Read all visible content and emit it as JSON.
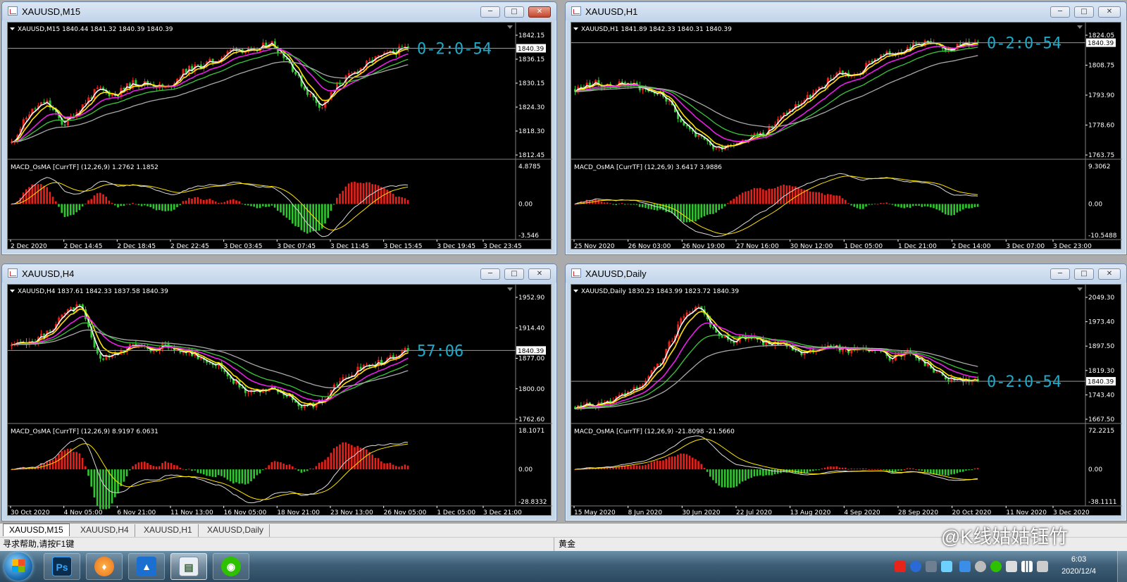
{
  "windows": [
    {
      "id": "m15",
      "title": "XAUUSD,M15",
      "active": true,
      "header": "XAUUSD,M15  1840.44 1841.32 1840.39 1840.39",
      "prices": [
        "1842.15",
        "1836.15",
        "1830.15",
        "1824.30",
        "1818.30",
        "1812.45"
      ],
      "bid": "1840.39",
      "timer": "0-2:0-54",
      "macd_header": "MACD_OsMA [CurrTF] (12,26,9) 1.2762 1.1852",
      "macd_scale": [
        "4.8785",
        "0.00",
        "-3.546"
      ],
      "times": [
        "2 Dec 2020",
        "2 Dec 14:45",
        "2 Dec 18:45",
        "2 Dec 22:45",
        "3 Dec 03:45",
        "3 Dec 07:45",
        "3 Dec 11:45",
        "3 Dec 15:45",
        "3 Dec 19:45",
        "3 Dec 23:45"
      ]
    },
    {
      "id": "h1",
      "title": "XAUUSD,H1",
      "active": false,
      "header": "XAUUSD,H1  1841.89 1842.33 1840.31 1840.39",
      "prices": [
        "1840.39",
        "1824.05",
        "1808.75",
        "1793.90",
        "1778.60",
        "1763.75"
      ],
      "bid": "1840.39",
      "timer": "0-2:0-54",
      "macd_header": "MACD_OsMA [CurrTF] (12,26,9) 3.6417 3.9886",
      "macd_scale": [
        "9.3062",
        "0.00",
        "-10.5488"
      ],
      "times": [
        "25 Nov 2020",
        "26 Nov 03:00",
        "26 Nov 19:00",
        "27 Nov 16:00",
        "30 Nov 12:00",
        "1 Dec 05:00",
        "1 Dec 21:00",
        "2 Dec 14:00",
        "3 Dec 07:00",
        "3 Dec 23:00"
      ]
    },
    {
      "id": "h4",
      "title": "XAUUSD,H4",
      "active": false,
      "header": "XAUUSD,H4  1837.61 1842.33 1837.58 1840.39",
      "prices": [
        "1952.90",
        "1914.40",
        "1877.00",
        "1840.39",
        "1800.00",
        "1762.60"
      ],
      "bid": "1840.39",
      "timer": "57:06",
      "macd_header": "MACD_OsMA [CurrTF] (12,26,9) 8.9197 6.0631",
      "macd_scale": [
        "18.1071",
        "0.00",
        "-28.8332"
      ],
      "times": [
        "30 Oct 2020",
        "4 Nov 05:00",
        "6 Nov 21:00",
        "11 Nov 13:00",
        "16 Nov 05:00",
        "18 Nov 21:00",
        "23 Nov 13:00",
        "26 Nov 05:00",
        "1 Dec 05:00",
        "3 Dec 21:00"
      ]
    },
    {
      "id": "d1",
      "title": "XAUUSD,Daily",
      "active": false,
      "header": "XAUUSD,Daily  1830.23 1843.99 1823.72 1840.39",
      "prices": [
        "2049.30",
        "1973.40",
        "1897.50",
        "1840.39",
        "1819.30",
        "1743.40",
        "1667.50"
      ],
      "bid": "1840.39",
      "timer": "0-2:0-54",
      "macd_header": "MACD_OsMA [CurrTF] (12,26,9) -21.8098 -21.5660",
      "macd_scale": [
        "72.2215",
        "0.00",
        "-38.1111"
      ],
      "times": [
        "15 May 2020",
        "8 Jun 2020",
        "30 Jun 2020",
        "22 Jul 2020",
        "13 Aug 2020",
        "4 Sep 2020",
        "28 Sep 2020",
        "20 Oct 2020",
        "11 Nov 2020",
        "3 Dec 2020"
      ]
    }
  ],
  "tabs": [
    "XAUUSD,M15",
    "XAUUSD,H4",
    "XAUUSD,H1",
    "XAUUSD,Daily"
  ],
  "status": {
    "help": "寻求帮助,请按F1键",
    "symbol": "黄金"
  },
  "clock": {
    "time": "6:03",
    "date": "2020/12/4"
  },
  "watermark": "@K线姑姑钰竹",
  "colors": {
    "bull": "#e8201a",
    "bear": "#2fc72f",
    "ma_white": "#ffffff",
    "ma_yellow": "#ffe400",
    "ma_magenta": "#e81ee8",
    "ma_green": "#3ac73a",
    "ma_gray": "#a9a9a9",
    "timer": "#1fa9c9"
  }
}
